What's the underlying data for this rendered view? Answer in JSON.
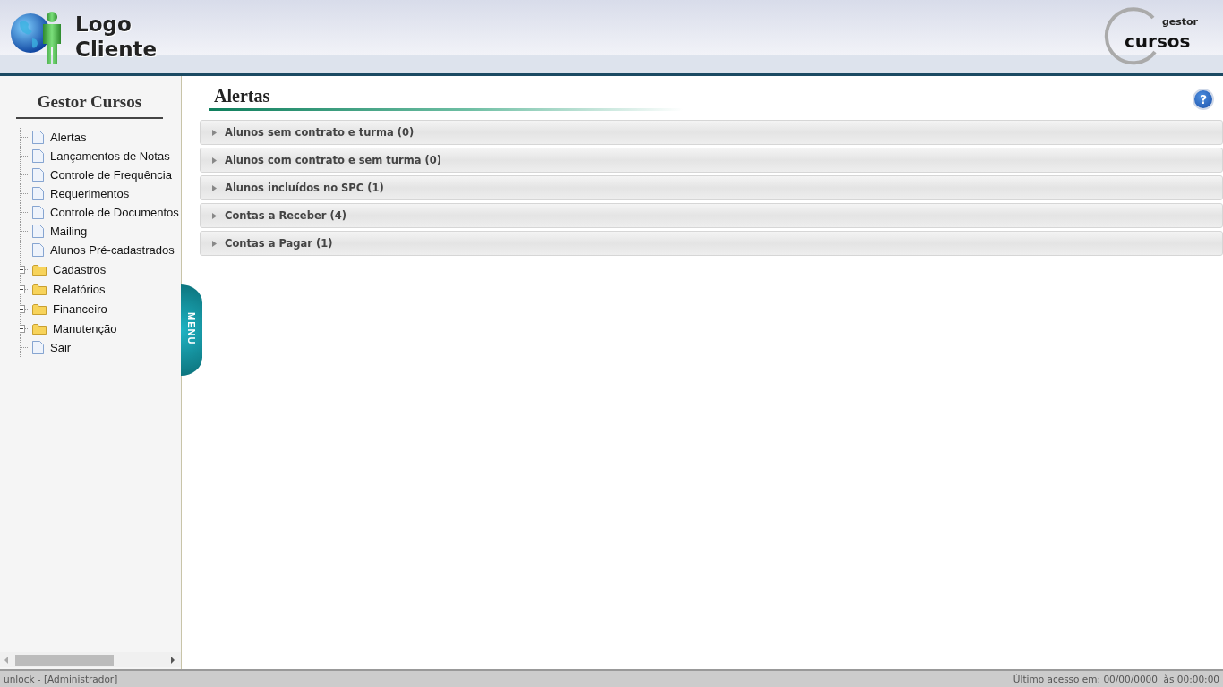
{
  "header": {
    "client_logo": "Logo Cliente",
    "product_logo": {
      "small": "gestor",
      "large": "cursos"
    }
  },
  "sidebar": {
    "title": "Gestor Cursos",
    "items": [
      {
        "kind": "page",
        "label": "Alertas"
      },
      {
        "kind": "page",
        "label": "Lançamentos de Notas"
      },
      {
        "kind": "page",
        "label": "Controle de Frequência"
      },
      {
        "kind": "page",
        "label": "Requerimentos"
      },
      {
        "kind": "page",
        "label": "Controle de Documentos"
      },
      {
        "kind": "page",
        "label": "Mailing"
      },
      {
        "kind": "page",
        "label": "Alunos Pré-cadastrados"
      },
      {
        "kind": "folder",
        "label": "Cadastros",
        "expanded": false
      },
      {
        "kind": "folder",
        "label": "Relatórios",
        "expanded": false
      },
      {
        "kind": "folder",
        "label": "Financeiro",
        "expanded": false
      },
      {
        "kind": "folder",
        "label": "Manutenção",
        "expanded": false
      },
      {
        "kind": "page",
        "label": "Sair"
      }
    ],
    "menu_tab": "MENU"
  },
  "page": {
    "title": "Alertas",
    "help": "?",
    "panels": [
      {
        "label": "Alunos sem contrato e turma (0)",
        "expanded": false
      },
      {
        "label": "Alunos com contrato e sem turma (0)",
        "expanded": false
      },
      {
        "label": "Alunos incluídos no SPC (1)",
        "expanded": false
      },
      {
        "label": "Contas a Receber (4)",
        "expanded": false
      },
      {
        "label": "Contas a Pagar (1)",
        "expanded": false
      }
    ]
  },
  "status_bar": {
    "user": "unlock - [Administrador]",
    "last_access": "Último acesso em: 00/00/0000  às 00:00:00"
  }
}
